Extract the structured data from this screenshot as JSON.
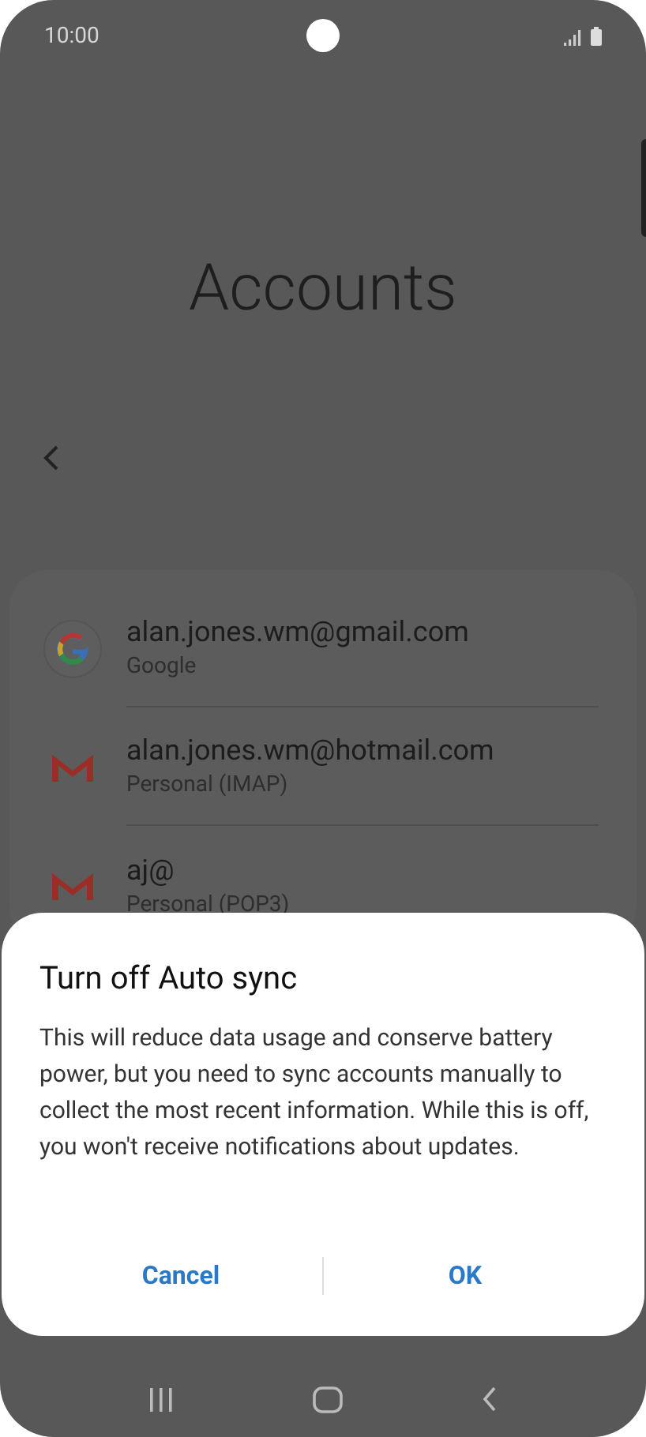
{
  "status_bar": {
    "time": "10:00"
  },
  "header": {
    "title": "Accounts"
  },
  "accounts": [
    {
      "kind": "google",
      "email": "alan.jones.wm@gmail.com",
      "type": "Google"
    },
    {
      "kind": "mail",
      "email": "alan.jones.wm@hotmail.com",
      "type": "Personal (IMAP)"
    },
    {
      "kind": "mail",
      "email": "aj@",
      "type": "Personal (POP3)"
    }
  ],
  "dialog": {
    "title": "Turn off Auto sync",
    "message": "This will reduce data usage and conserve battery power, but you need to sync accounts manually to collect the most recent information. While this is off, you won't receive notifications about updates.",
    "buttons": [
      "Cancel",
      "OK"
    ]
  }
}
